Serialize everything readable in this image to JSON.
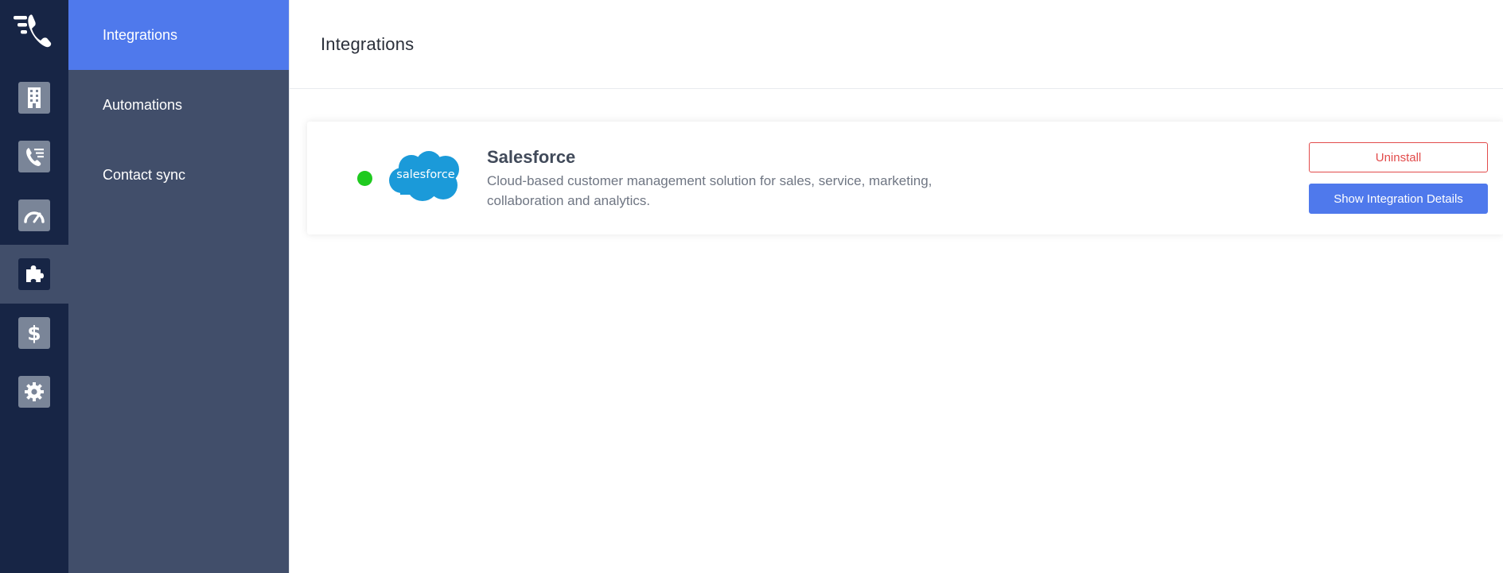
{
  "colors": {
    "rail_bg": "#172545",
    "subnav_bg": "#414e6a",
    "accent": "#4f79ec",
    "status_active": "#1fca1f",
    "danger": "#e24b4b",
    "salesforce_blue": "#1b9ad9"
  },
  "rail": {
    "logo_icon": "phone-call-logo-icon",
    "items": [
      {
        "icon": "building-icon",
        "active": false
      },
      {
        "icon": "call-queue-icon",
        "active": false
      },
      {
        "icon": "speedometer-icon",
        "active": false
      },
      {
        "icon": "puzzle-piece-icon",
        "active": true
      },
      {
        "icon": "dollar-icon",
        "active": false
      },
      {
        "icon": "gear-icon",
        "active": false
      }
    ]
  },
  "subnav": {
    "items": [
      {
        "label": "Integrations",
        "active": true
      },
      {
        "label": "Automations",
        "active": false
      },
      {
        "label": "Contact sync",
        "active": false
      }
    ]
  },
  "main": {
    "title": "Integrations",
    "integration": {
      "name": "Salesforce",
      "logo_text": "salesforce",
      "description": "Cloud-based customer management solution for sales, service, marketing, collaboration and analytics.",
      "status": "active",
      "uninstall_label": "Uninstall",
      "details_label": "Show Integration Details"
    }
  }
}
